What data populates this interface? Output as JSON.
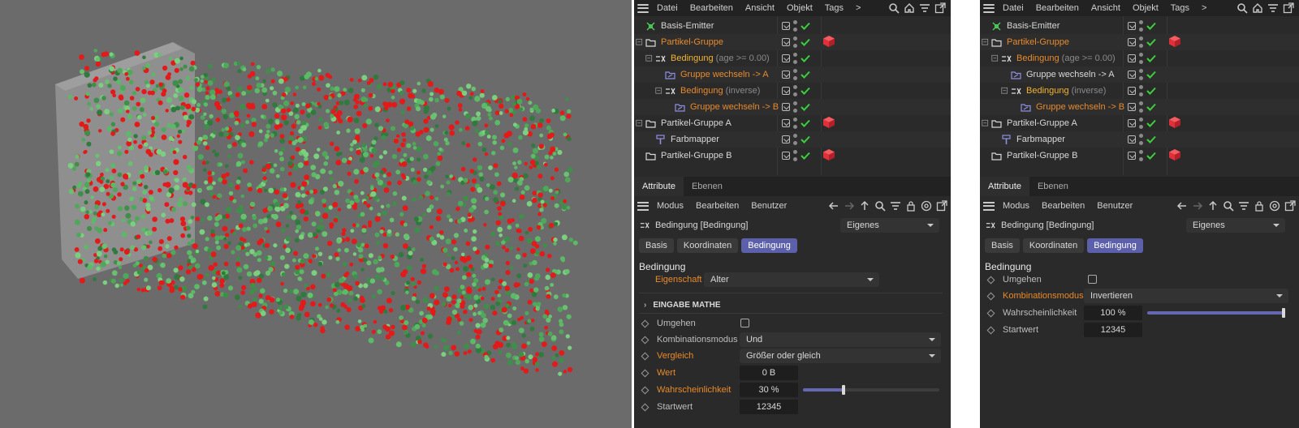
{
  "menubar": {
    "items": [
      "Datei",
      "Bearbeiten",
      "Ansicht",
      "Objekt",
      "Tags",
      ">"
    ]
  },
  "tree": {
    "rows": [
      {
        "label": "Basis-Emitter",
        "suffix": "",
        "color": "white",
        "icon": "emitter-icon"
      },
      {
        "label": "Partikel-Gruppe",
        "suffix": "",
        "color": "orange",
        "icon": "folder-icon"
      },
      {
        "label": "Bedingung",
        "suffix": "(age >= 0.00)",
        "color": "yellow",
        "icon": "condition-icon"
      },
      {
        "label": "Gruppe wechseln -> A",
        "suffix": "",
        "color": "orange",
        "icon": "switch-group-icon"
      },
      {
        "label": "Bedingung",
        "suffix": "(inverse)",
        "color": "yellow",
        "icon": "condition-icon"
      },
      {
        "label": "Gruppe wechseln -> B",
        "suffix": "",
        "color": "orange",
        "icon": "switch-group-icon"
      },
      {
        "label": "Partikel-Gruppe A",
        "suffix": "",
        "color": "white",
        "icon": "folder-icon"
      },
      {
        "label": "Farbmapper",
        "suffix": "",
        "color": "white",
        "icon": "color-mapper-icon"
      },
      {
        "label": "Partikel-Gruppe B",
        "suffix": "",
        "color": "white",
        "icon": "folder-icon"
      }
    ],
    "right_rows": [
      {
        "label": "Basis-Emitter",
        "suffix": "",
        "color": "white"
      },
      {
        "label": "Partikel-Gruppe",
        "suffix": "",
        "color": "orange"
      },
      {
        "label": "Bedingung",
        "suffix": "(age >= 0.00)",
        "color": "orange"
      },
      {
        "label": "Gruppe wechseln -> A",
        "suffix": "",
        "color": "white"
      },
      {
        "label": "Bedingung",
        "suffix": "(inverse)",
        "color": "yellow"
      },
      {
        "label": "Gruppe wechseln -> B",
        "suffix": "",
        "color": "orange"
      },
      {
        "label": "Partikel-Gruppe A",
        "suffix": "",
        "color": "white"
      },
      {
        "label": "Farbmapper",
        "suffix": "",
        "color": "white"
      },
      {
        "label": "Partikel-Gruppe B",
        "suffix": "",
        "color": "white"
      }
    ]
  },
  "attributes": {
    "tabs": [
      "Attribute",
      "Ebenen"
    ],
    "menu": [
      "Modus",
      "Bearbeiten",
      "Benutzer"
    ],
    "object_title": "Bedingung [Bedingung]",
    "mode_dropdown": "Eigenes",
    "sub_tabs": [
      "Basis",
      "Koordinaten",
      "Bedingung"
    ],
    "section_title": "Bedingung"
  },
  "left_params": {
    "eigenschaft_label": "Eigenschaft",
    "eigenschaft_value": "Alter",
    "group_label": "EINGABE MATHE",
    "umgehen_label": "Umgehen",
    "kombination_label": "Kombinationsmodus",
    "kombination_value": "Und",
    "vergleich_label": "Vergleich",
    "vergleich_value": "Größer oder gleich",
    "wert_label": "Wert",
    "wert_value": "0 B",
    "wahrschein_label": "Wahrscheinlichkeit",
    "wahrschein_value": "30 %",
    "wahrschein_fraction": 0.3,
    "startwert_label": "Startwert",
    "startwert_value": "12345"
  },
  "right_params": {
    "umgehen_label": "Umgehen",
    "kombination_label": "Kombinationsmodus",
    "kombination_value": "Invertieren",
    "wahrschein_label": "Wahrscheinlichkeit",
    "wahrschein_value": "100 %",
    "wahrschein_fraction": 1.0,
    "startwert_label": "Startwert",
    "startwert_value": "12345"
  },
  "colors": {
    "accent": "#5c5fa9",
    "orange_label": "#e98a2a",
    "yellow_label": "#f3b330",
    "check_green": "#3ccf3c",
    "tag_red": "#e0303a",
    "particle_red": "#e31a1a",
    "particle_green": "#4fa85a",
    "viewport_bg": "#6b6b6b"
  }
}
